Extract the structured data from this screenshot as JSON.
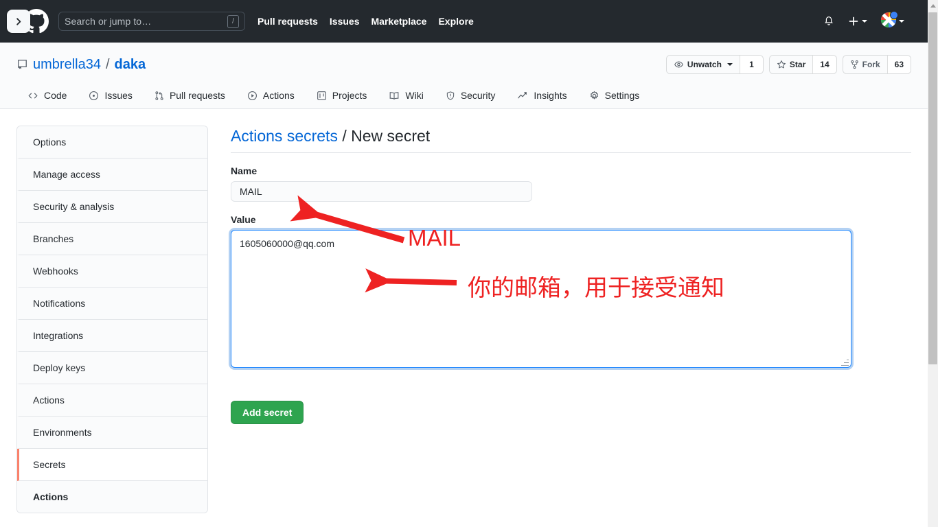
{
  "header": {
    "sidebar_toggle_icon": "chevron-right-icon",
    "logo_icon": "github-logo-icon",
    "search": {
      "placeholder": "Search or jump to…",
      "shortcut_key": "/"
    },
    "nav": [
      {
        "label": "Pull requests"
      },
      {
        "label": "Issues"
      },
      {
        "label": "Marketplace"
      },
      {
        "label": "Explore"
      }
    ],
    "notifications_icon": "bell-icon",
    "create_new_icon": "plus-icon",
    "avatar_icon": "user-avatar",
    "dark_bg": "#24292e"
  },
  "repo": {
    "icon": "repo-icon",
    "owner": "umbrella34",
    "separator": "/",
    "name": "daka",
    "actions": [
      {
        "icon": "eye-icon",
        "label": "Unwatch",
        "has_caret": true,
        "count": "1"
      },
      {
        "icon": "star-icon",
        "label": "Star",
        "has_caret": false,
        "count": "14"
      },
      {
        "icon": "fork-icon",
        "label": "Fork",
        "has_caret": false,
        "count": "63"
      }
    ],
    "tabs": [
      {
        "icon": "code-icon",
        "label": "Code"
      },
      {
        "icon": "issue-opened-icon",
        "label": "Issues"
      },
      {
        "icon": "git-pull-request-icon",
        "label": "Pull requests"
      },
      {
        "icon": "play-icon",
        "label": "Actions"
      },
      {
        "icon": "project-icon",
        "label": "Projects"
      },
      {
        "icon": "book-icon",
        "label": "Wiki"
      },
      {
        "icon": "shield-icon",
        "label": "Security"
      },
      {
        "icon": "graph-icon",
        "label": "Insights"
      },
      {
        "icon": "gear-icon",
        "label": "Settings"
      }
    ]
  },
  "sidebar": {
    "items": [
      {
        "label": "Options",
        "selected": false,
        "group_head": false
      },
      {
        "label": "Manage access",
        "selected": false,
        "group_head": false
      },
      {
        "label": "Security & analysis",
        "selected": false,
        "group_head": false
      },
      {
        "label": "Branches",
        "selected": false,
        "group_head": false
      },
      {
        "label": "Webhooks",
        "selected": false,
        "group_head": false
      },
      {
        "label": "Notifications",
        "selected": false,
        "group_head": false
      },
      {
        "label": "Integrations",
        "selected": false,
        "group_head": false
      },
      {
        "label": "Deploy keys",
        "selected": false,
        "group_head": false
      },
      {
        "label": "Actions",
        "selected": false,
        "group_head": false
      },
      {
        "label": "Environments",
        "selected": false,
        "group_head": false
      },
      {
        "label": "Secrets",
        "selected": true,
        "group_head": false
      },
      {
        "label": "Actions",
        "selected": false,
        "group_head": true
      }
    ],
    "selected_accent": "#f9826c"
  },
  "content": {
    "heading_link": "Actions secrets",
    "heading_separator": "/",
    "heading_current": "New secret",
    "name_label": "Name",
    "name_value": "MAIL",
    "value_label": "Value",
    "value_value": "1605060000@qq.com",
    "submit_label": "Add secret",
    "submit_color": "#2ea44f"
  },
  "annotations": {
    "color": "#ee2222",
    "name_note": "MAIL",
    "value_note": "你的邮箱，用于接受通知",
    "arrow_to_name": "arrow-pointing-to-name-field",
    "arrow_to_value": "arrow-pointing-to-value-field"
  },
  "scrollbar": {
    "up_arrow_icon": "scroll-up-arrow-icon",
    "thumb": "scroll-thumb"
  }
}
